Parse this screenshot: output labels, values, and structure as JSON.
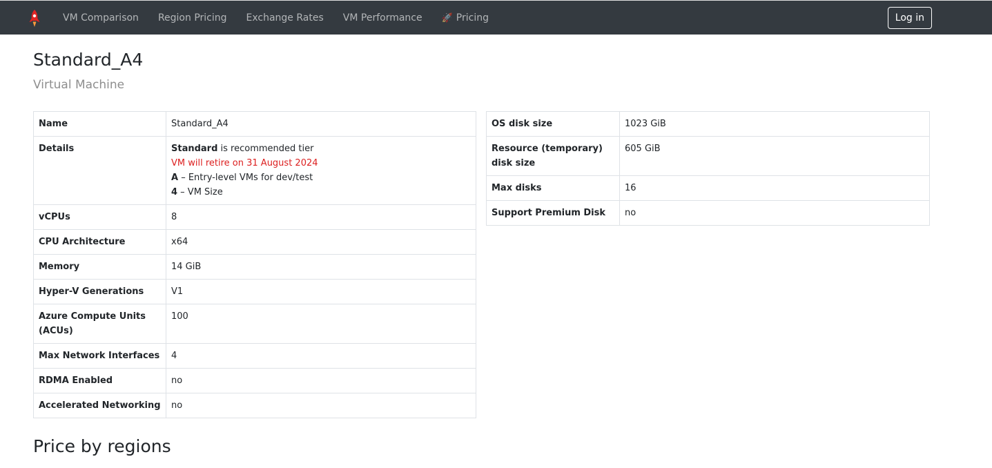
{
  "nav": {
    "items": [
      {
        "label": "VM Comparison"
      },
      {
        "label": "Region Pricing"
      },
      {
        "label": "Exchange Rates"
      },
      {
        "label": "VM Performance"
      },
      {
        "label": "Pricing"
      }
    ],
    "login_label": "Log in"
  },
  "header": {
    "title": "Standard_A4",
    "subtitle": "Virtual Machine"
  },
  "specs_left": {
    "name": {
      "key": "Name",
      "value": "Standard_A4"
    },
    "details": {
      "key": "Details",
      "tier_bold": "Standard",
      "tier_rest": " is recommended tier",
      "retire": "VM will retire on 31 August 2024",
      "family_bold": "A",
      "family_rest": " – Entry-level VMs for dev/test",
      "size_bold": "4",
      "size_rest": " – VM Size"
    },
    "vcpus": {
      "key": "vCPUs",
      "value": "8"
    },
    "cpu_arch": {
      "key": "CPU Architecture",
      "value": "x64"
    },
    "memory": {
      "key": "Memory",
      "value": "14 GiB"
    },
    "hyperv": {
      "key": "Hyper-V Generations",
      "value": "V1"
    },
    "acu": {
      "key": "Azure Compute Units (ACUs)",
      "value": "100"
    },
    "max_nics": {
      "key": "Max Network Interfaces",
      "value": "4"
    },
    "rdma": {
      "key": "RDMA Enabled",
      "value": "no"
    },
    "accel_net": {
      "key": "Accelerated Networking",
      "value": "no"
    }
  },
  "specs_right": {
    "os_disk": {
      "key": "OS disk size",
      "value": "1023 GiB"
    },
    "temp_disk": {
      "key": "Resource (temporary) disk size",
      "value": "605 GiB"
    },
    "max_disks": {
      "key": "Max disks",
      "value": "16"
    },
    "premium": {
      "key": "Support Premium Disk",
      "value": "no"
    }
  },
  "sections": {
    "price_title": "Price by regions"
  },
  "colors": {
    "navbar_bg": "#343a40",
    "retire_text": "#dc1f1f",
    "brand_red": "#e02424"
  },
  "icons": {
    "brand": "rocket-logo-icon",
    "pricing": "rocket-icon"
  }
}
